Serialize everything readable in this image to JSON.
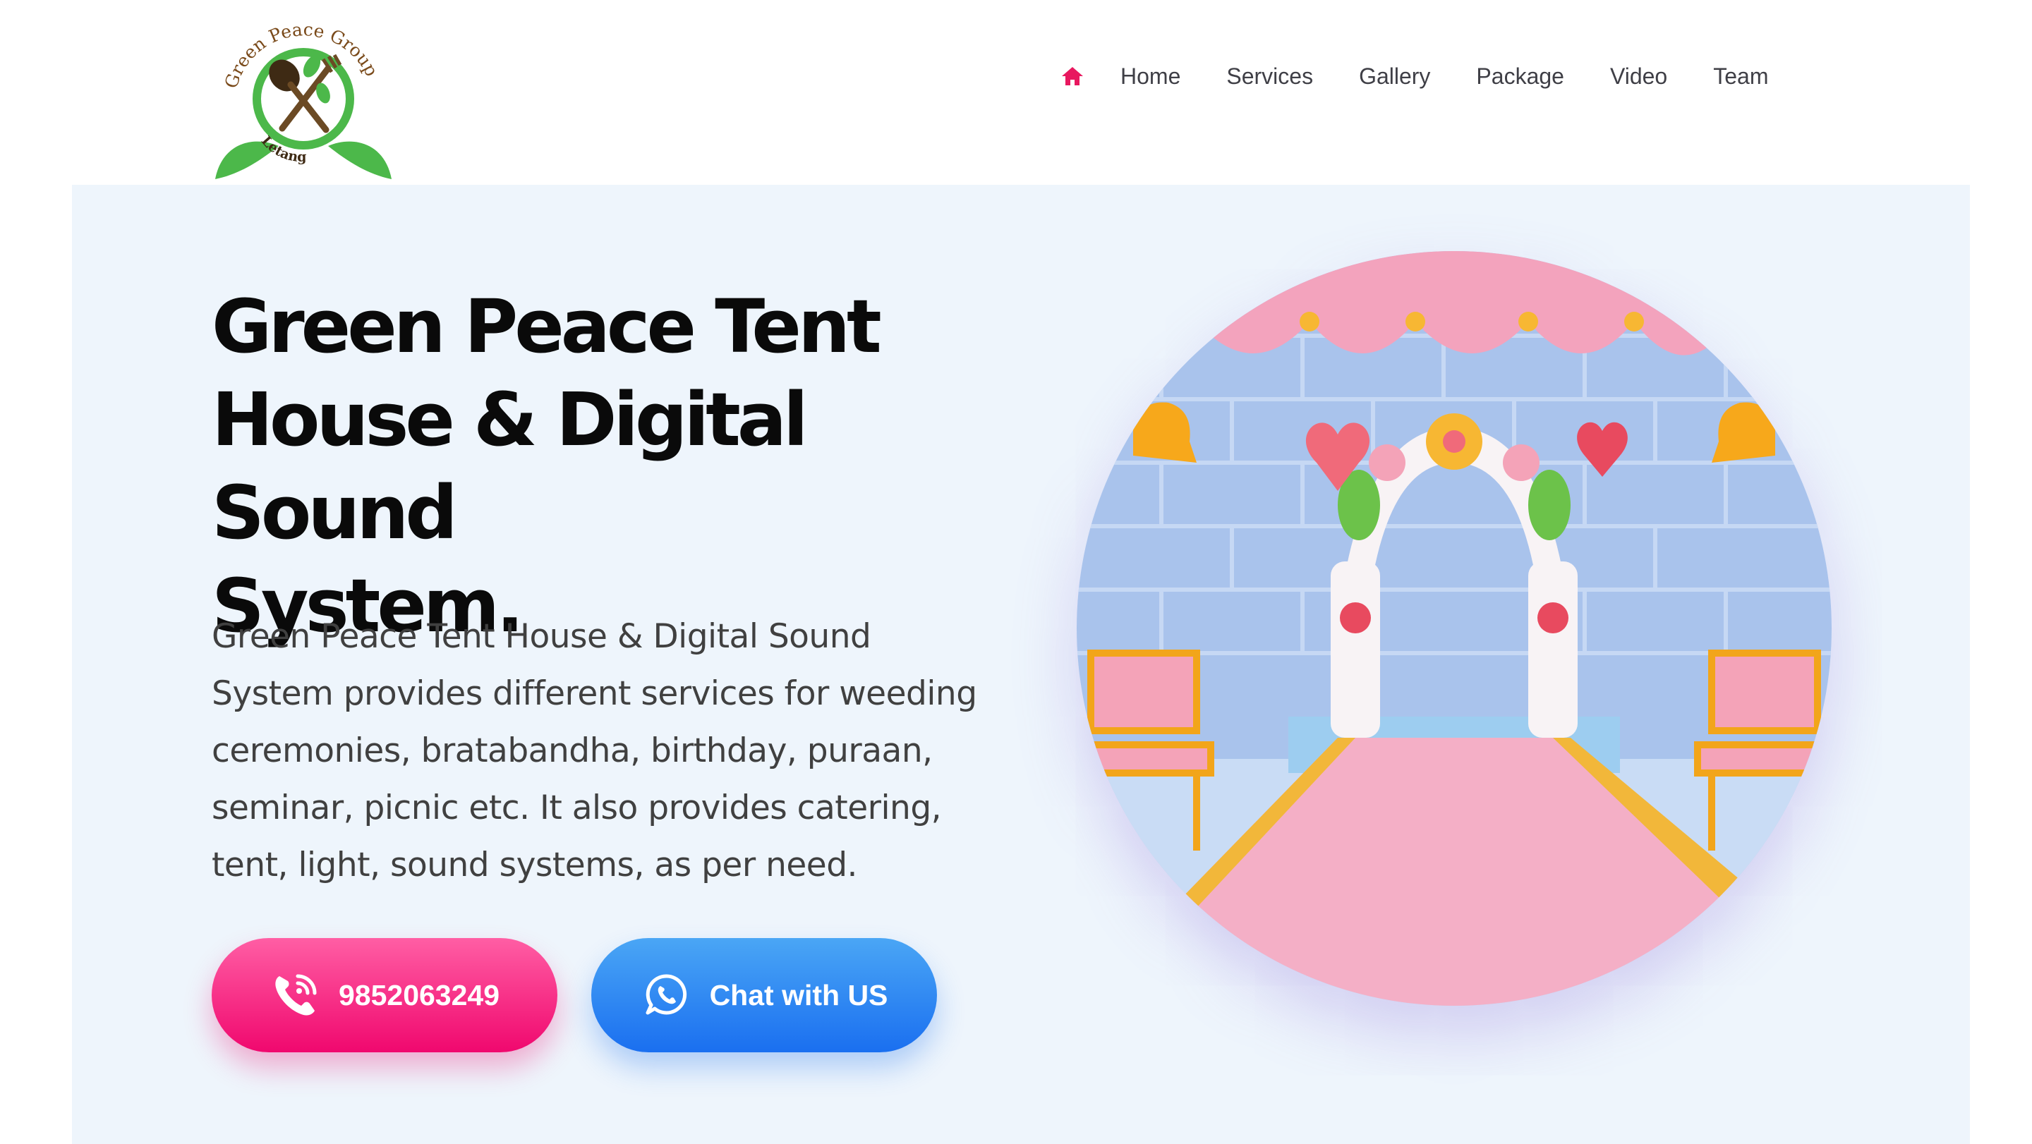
{
  "header": {
    "logo": {
      "text_top": "Green Peace Group",
      "text_bottom": "Letang"
    },
    "nav": {
      "home_icon": "home-icon",
      "items": [
        "Home",
        "Services",
        "Gallery",
        "Package",
        "Video",
        "Team"
      ]
    }
  },
  "hero": {
    "title_lines": [
      "Green Peace Tent",
      "House & Digital Sound",
      "System."
    ],
    "description_lines": [
      "Green Peace Tent House & Digital Sound",
      "System provides different services for weeding",
      "ceremonies, bratabandha, birthday, puraan,",
      "seminar, picnic etc. It also provides catering,",
      "tent, light, sound systems, as per need."
    ],
    "phone_button": {
      "label": "9852063249",
      "icon": "phone-call-icon",
      "color": "#f0086e"
    },
    "chat_button": {
      "label": "Chat with US",
      "icon": "whatsapp-icon",
      "color": "#1a6ff0"
    },
    "image": {
      "subject": "wedding-stage-illustration"
    }
  },
  "colors": {
    "accent_pink": "#f0086e",
    "accent_blue": "#1a6ff0",
    "hero_bg": "#eef5fc",
    "nav_home": "#e8185f"
  }
}
